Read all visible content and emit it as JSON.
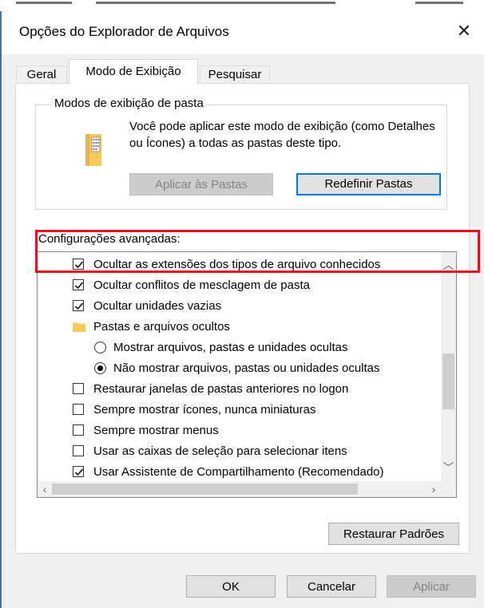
{
  "window": {
    "title": "Opções do Explorador de Arquivos"
  },
  "tabs": [
    {
      "label": "Geral"
    },
    {
      "label": "Modo de Exibição"
    },
    {
      "label": "Pesquisar"
    }
  ],
  "folder_views": {
    "legend": "Modos de exibição de pasta",
    "description": "Você pode aplicar este modo de exibição (como Detalhes ou Ícones) a todas as pastas deste tipo.",
    "apply_button": "Aplicar às Pastas",
    "reset_button": "Redefinir Pastas"
  },
  "advanced": {
    "label": "Configurações avançadas:",
    "items": [
      {
        "type": "checkbox",
        "checked": true,
        "label": "Ocultar as extensões dos tipos de arquivo conhecidos"
      },
      {
        "type": "checkbox",
        "checked": true,
        "label": "Ocultar conflitos de mesclagem de pasta"
      },
      {
        "type": "checkbox",
        "checked": true,
        "label": "Ocultar unidades vazias"
      },
      {
        "type": "folder",
        "label": "Pastas e arquivos ocultos"
      },
      {
        "type": "radio",
        "checked": false,
        "label": "Mostrar arquivos, pastas e unidades ocultas"
      },
      {
        "type": "radio",
        "checked": true,
        "label": "Não mostrar arquivos, pastas ou unidades ocultas"
      },
      {
        "type": "checkbox",
        "checked": false,
        "label": "Restaurar janelas de pastas anteriores no logon"
      },
      {
        "type": "checkbox",
        "checked": false,
        "label": "Sempre mostrar ícones, nunca miniaturas"
      },
      {
        "type": "checkbox",
        "checked": false,
        "label": "Sempre mostrar menus"
      },
      {
        "type": "checkbox",
        "checked": false,
        "label": "Usar as caixas de seleção para selecionar itens"
      },
      {
        "type": "checkbox",
        "checked": true,
        "label": "Usar Assistente de Compartilhamento (Recomendado)"
      }
    ],
    "restore_button": "Restaurar Padrões"
  },
  "footer": {
    "ok": "OK",
    "cancel": "Cancelar",
    "apply": "Aplicar"
  },
  "icons": {
    "close": "close-icon",
    "folder": "folder-icon",
    "scroll_up": "chevron-up-icon",
    "scroll_down": "chevron-down-icon",
    "scroll_left": "chevron-left-icon",
    "scroll_right": "chevron-right-icon"
  },
  "colors": {
    "highlight": "#e81123",
    "focus": "#0078d7",
    "folder": "#f7d68a"
  }
}
